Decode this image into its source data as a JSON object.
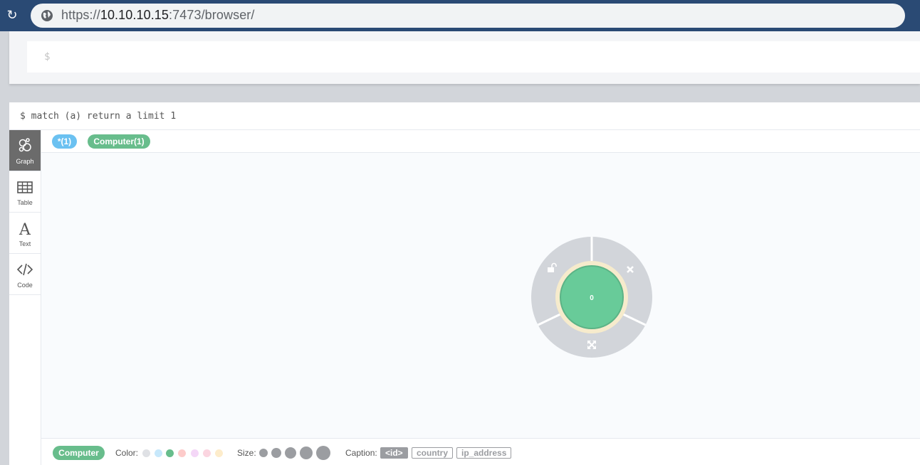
{
  "browser": {
    "url_scheme": "https://",
    "url_host": "10.10.10.15",
    "url_rest": ":7473/browser/"
  },
  "editor": {
    "prompt": "$"
  },
  "frame": {
    "query": "$ match (a) return a limit 1",
    "sidebar": [
      {
        "label": "Graph",
        "icon": "graph-icon",
        "active": true
      },
      {
        "label": "Table",
        "icon": "table-icon",
        "active": false
      },
      {
        "label": "Text",
        "icon": "text-icon",
        "active": false
      },
      {
        "label": "Code",
        "icon": "code-icon",
        "active": false
      }
    ],
    "pills": [
      {
        "label": "*(1)",
        "color": "#6bc1f1"
      },
      {
        "label": "Computer(1)",
        "color": "#68bd8c"
      }
    ],
    "node": {
      "caption": "0",
      "color": "#68cb99",
      "ring_color": "#f6ebcc",
      "menu_color": "#d2d5da"
    },
    "legend": {
      "label": "Computer",
      "color_label": "Color:",
      "colors": [
        "#dfe1e5",
        "#c7e8fb",
        "#68bd8c",
        "#fdcbca",
        "#f4d7f7",
        "#fbd5e0",
        "#fdeccb"
      ],
      "size_label": "Size:",
      "caption_label": "Caption:",
      "captions": [
        {
          "label": "<id>",
          "selected": true
        },
        {
          "label": "country",
          "selected": false
        },
        {
          "label": "ip_address",
          "selected": false
        }
      ]
    }
  }
}
